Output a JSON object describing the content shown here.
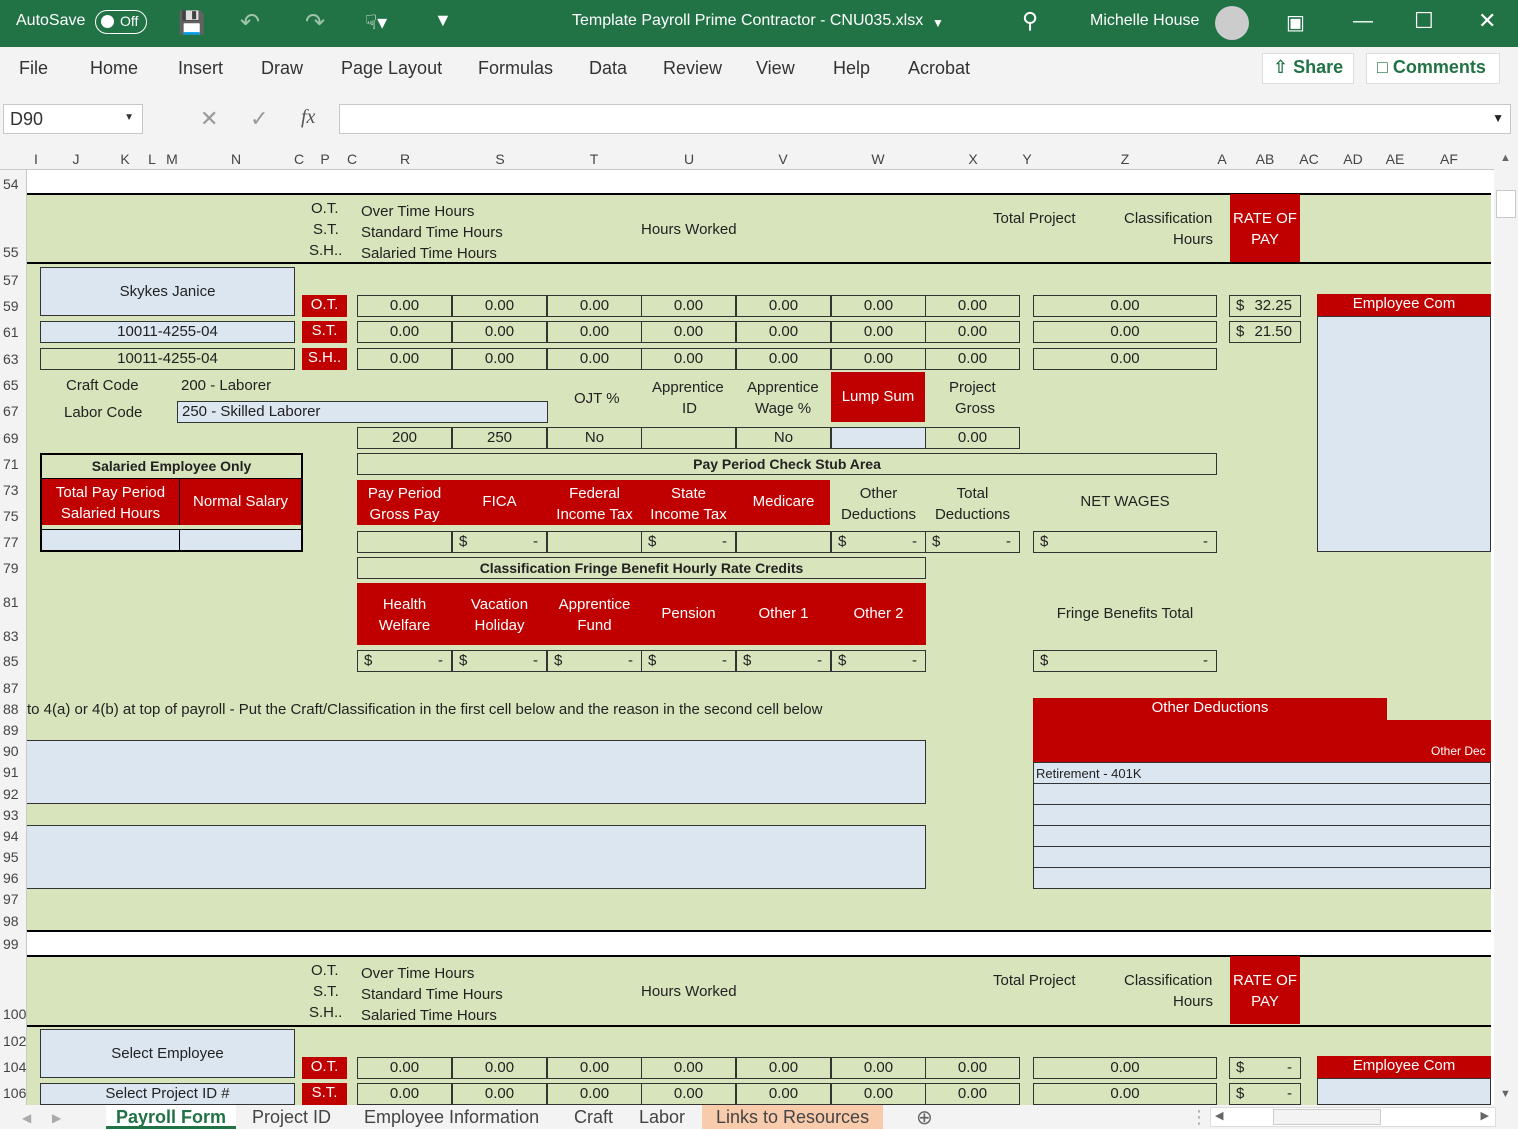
{
  "titlebar": {
    "autosave": "AutoSave",
    "toggle": "Off",
    "filename": "Template Payroll Prime Contractor - CNU035.xlsx",
    "user": "Michelle House"
  },
  "menu": {
    "file": "File",
    "home": "Home",
    "insert": "Insert",
    "draw": "Draw",
    "page_layout": "Page Layout",
    "formulas": "Formulas",
    "data": "Data",
    "review": "Review",
    "view": "View",
    "help": "Help",
    "acrobat": "Acrobat",
    "share": "Share",
    "comments": "Comments"
  },
  "formula_bar": {
    "name_box": "D90",
    "value": ""
  },
  "columns": [
    "I",
    "J",
    "K",
    "L",
    "M",
    "N",
    "C",
    "P",
    "C",
    "R",
    "S",
    "T",
    "U",
    "V",
    "W",
    "X",
    "Y",
    "Z",
    "A",
    "AB",
    "AC",
    "AD",
    "AE",
    "AF"
  ],
  "rows": [
    "54",
    "55",
    "57",
    "59",
    "61",
    "63",
    "65",
    "67",
    "69",
    "71",
    "73",
    "75",
    "77",
    "79",
    "81",
    "83",
    "85",
    "87",
    "88",
    "89",
    "90",
    "91",
    "92",
    "93",
    "94",
    "95",
    "96",
    "97",
    "98",
    "99",
    "100",
    "102",
    "104",
    "106"
  ],
  "hdr": {
    "ot": "O.T.",
    "st": "S.T.",
    "sh": "S.H..",
    "over": "Over Time Hours",
    "standard": "Standard Time Hours",
    "salaried": "Salaried Time Hours",
    "hours_worked": "Hours Worked",
    "total_project": "Total Project",
    "classification": "Classification",
    "hours": "Hours",
    "rate": "RATE OF",
    "pay": "PAY"
  },
  "employee": {
    "name": "Skykes Janice",
    "id1": "10011-4255-04",
    "id2": "10011-4255-04",
    "zero": "0.00",
    "rate_ot_sym": "$",
    "rate_ot": "32.25",
    "rate_st_sym": "$",
    "rate_st": "21.50",
    "employee_comments": "Employee Com"
  },
  "codes": {
    "craft_label": "Craft Code",
    "craft_value": "200 - Laborer",
    "labor_label": "Labor Code",
    "labor_value": "250 - Skilled Laborer",
    "ojt": "OJT %",
    "app_id1": "Apprentice",
    "app_id2": "ID",
    "app_wage1": "Apprentice",
    "app_wage2": "Wage %",
    "lump": "Lump Sum",
    "proj_gross1": "Project",
    "proj_gross2": "Gross",
    "v200": "200",
    "v250": "250",
    "no1": "No",
    "no2": "No",
    "gross": "0.00"
  },
  "salaried": {
    "title": "Salaried Employee Only",
    "total1": "Total Pay Period",
    "total2": "Salaried Hours",
    "normal": "Normal Salary"
  },
  "stub": {
    "title": "Pay Period Check Stub Area",
    "pp1": "Pay Period",
    "pp2": "Gross Pay",
    "fica": "FICA",
    "fed1": "Federal",
    "fed2": "Income Tax",
    "state1": "State",
    "state2": "Income Tax",
    "medicare": "Medicare",
    "other1": "Other",
    "other2": "Deductions",
    "total1": "Total",
    "total2": "Deductions",
    "net": "NET WAGES",
    "dollar": "$",
    "dash": "-"
  },
  "fringe": {
    "title": "Classification Fringe Benefit Hourly Rate Credits",
    "health1": "Health",
    "health2": "Welfare",
    "vac1": "Vacation",
    "vac2": "Holiday",
    "app1": "Apprentice",
    "app2": "Fund",
    "pension": "Pension",
    "other1": "Other 1",
    "other2": "Other 2",
    "total": "Fringe Benefits  Total"
  },
  "notes": {
    "text": "to 4(a) or 4(b) at top of payroll - Put the Craft/Classification in the first cell below and the reason in the second cell below",
    "other_deductions": "Other Deductions",
    "other_ded2": "Other Dec",
    "retirement": "Retirement - 401K"
  },
  "employee2": {
    "select_emp": "Select Employee",
    "select_proj": "Select Project ID #",
    "dash": "-"
  },
  "sheets": [
    "Payroll Form",
    "Project ID",
    "Employee Information",
    "Craft",
    "Labor",
    "Links to Resources"
  ]
}
